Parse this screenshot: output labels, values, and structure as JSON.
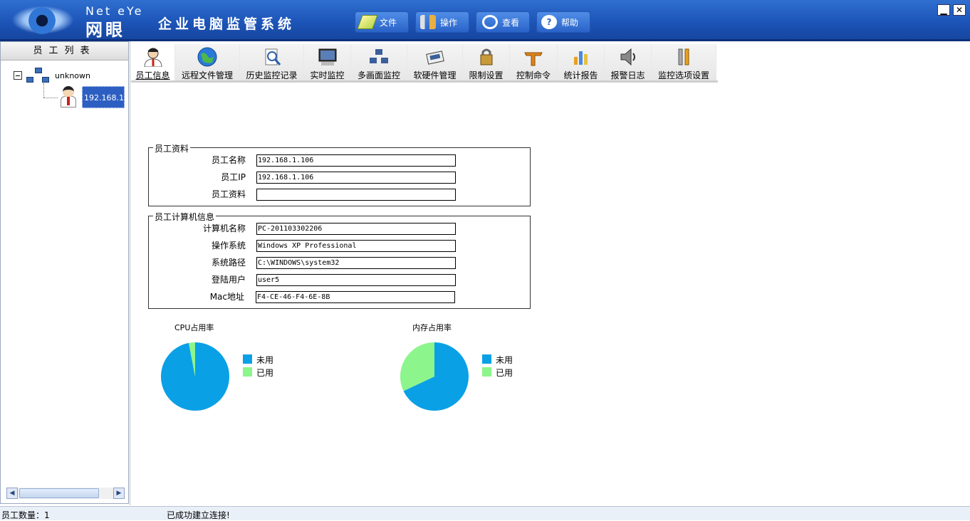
{
  "brand": {
    "en": "Net eYe",
    "cn": "网眼"
  },
  "app_title": "企业电脑监管系统",
  "top_menu": [
    {
      "label": "文件",
      "icon": "file-icon"
    },
    {
      "label": "操作",
      "icon": "tools-icon"
    },
    {
      "label": "查看",
      "icon": "magnifier-icon"
    },
    {
      "label": "帮助",
      "icon": "help-icon"
    }
  ],
  "window_controls": {
    "minimize": "▁",
    "close": "✕"
  },
  "sidebar": {
    "header": "员工列表",
    "tree": {
      "root_label": "unknown",
      "child_label": "192.168.1"
    }
  },
  "tabs": [
    {
      "label": "员工信息",
      "icon": "user-icon",
      "active": true
    },
    {
      "label": "远程文件管理",
      "icon": "globe-icon",
      "active": false
    },
    {
      "label": "历史监控记录",
      "icon": "search-doc-icon",
      "active": false
    },
    {
      "label": "实时监控",
      "icon": "monitor-icon",
      "active": false
    },
    {
      "label": "多画面监控",
      "icon": "multi-screen-icon",
      "active": false
    },
    {
      "label": "软硬件管理",
      "icon": "hardware-icon",
      "active": false
    },
    {
      "label": "限制设置",
      "icon": "lock-icon",
      "active": false
    },
    {
      "label": "控制命令",
      "icon": "command-icon",
      "active": false
    },
    {
      "label": "统计报告",
      "icon": "report-icon",
      "active": false
    },
    {
      "label": "报警日志",
      "icon": "speaker-icon",
      "active": false
    },
    {
      "label": "监控选项设置",
      "icon": "settings-icon",
      "active": false
    }
  ],
  "employee_info": {
    "group_title": "员工资料",
    "fields": [
      {
        "label": "员工名称",
        "value": "192.168.1.106"
      },
      {
        "label": "员工IP",
        "value": "192.168.1.106"
      },
      {
        "label": "员工资料",
        "value": ""
      }
    ]
  },
  "computer_info": {
    "group_title": "员工计算机信息",
    "fields": [
      {
        "label": "计算机名称",
        "value": "PC-201103302206"
      },
      {
        "label": "操作系统",
        "value": "Windows XP Professional"
      },
      {
        "label": "系统路径",
        "value": "C:\\WINDOWS\\system32"
      },
      {
        "label": "登陆用户",
        "value": "user5"
      },
      {
        "label": "Mac地址",
        "value": "F4-CE-46-F4-6E-8B"
      }
    ]
  },
  "colors": {
    "unused": "#0aa0e6",
    "used": "#8cf58c"
  },
  "chart_data": [
    {
      "type": "pie",
      "title": "CPU占用率",
      "categories": [
        "未用",
        "已用"
      ],
      "values": [
        97,
        3
      ]
    },
    {
      "type": "pie",
      "title": "内存占用率",
      "categories": [
        "未用",
        "已用"
      ],
      "values": [
        68,
        32
      ]
    }
  ],
  "status": {
    "count": "员工数量：1",
    "message": "已成功建立连接!"
  }
}
